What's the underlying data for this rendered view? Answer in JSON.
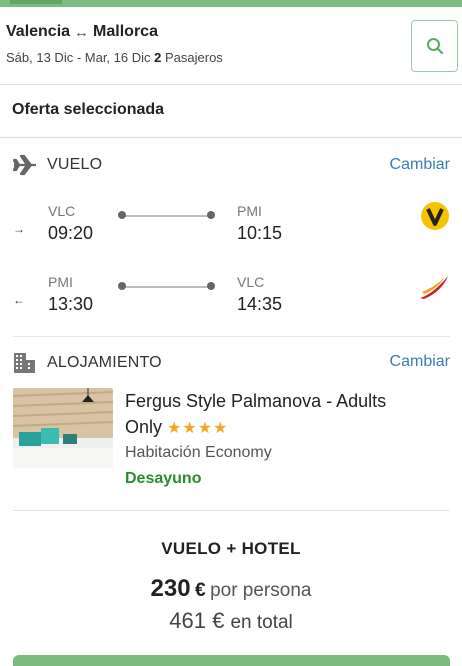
{
  "header": {
    "origin": "Valencia",
    "swap_symbol": "↔",
    "destination": "Mallorca",
    "dates": "Sáb, 13 Dic - Mar, 16 Dic",
    "passenger_count": "2",
    "passenger_label": "Pasajeros",
    "search_icon": "search-icon"
  },
  "offer": {
    "title": "Oferta seleccionada"
  },
  "flight": {
    "section_label": "VUELO",
    "change_label": "Cambiar",
    "icon": "plane-icon",
    "outbound": {
      "direction_icon": "→",
      "from_code": "VLC",
      "from_time": "09:20",
      "to_code": "PMI",
      "to_time": "10:15",
      "airline_logo": "vueling-logo",
      "airline_letter": "V",
      "airline_color": "#f5c400"
    },
    "inbound": {
      "direction_icon": "←",
      "from_code": "PMI",
      "from_time": "13:30",
      "to_code": "VLC",
      "to_time": "14:35",
      "airline_logo": "iberia-logo",
      "airline_color": "#d7192d"
    }
  },
  "accommodation": {
    "section_label": "ALOJAMIENTO",
    "change_label": "Cambiar",
    "icon": "building-icon",
    "hotel_name_line": "Fergus Style Palmanova - Adults",
    "hotel_name_rest": "Only",
    "stars": "★★★★",
    "room_type": "Habitación Economy",
    "board": "Desayuno"
  },
  "summary": {
    "package_label": "VUELO + HOTEL",
    "price_per_person": "230",
    "currency": "€",
    "per_person_label": "por persona",
    "price_total": "461",
    "total_label": "en total"
  },
  "colors": {
    "brand_green": "#7cbb7f",
    "link_blue": "#3d7ab8",
    "board_green": "#2e8b2e",
    "star_yellow": "#f5a623"
  }
}
